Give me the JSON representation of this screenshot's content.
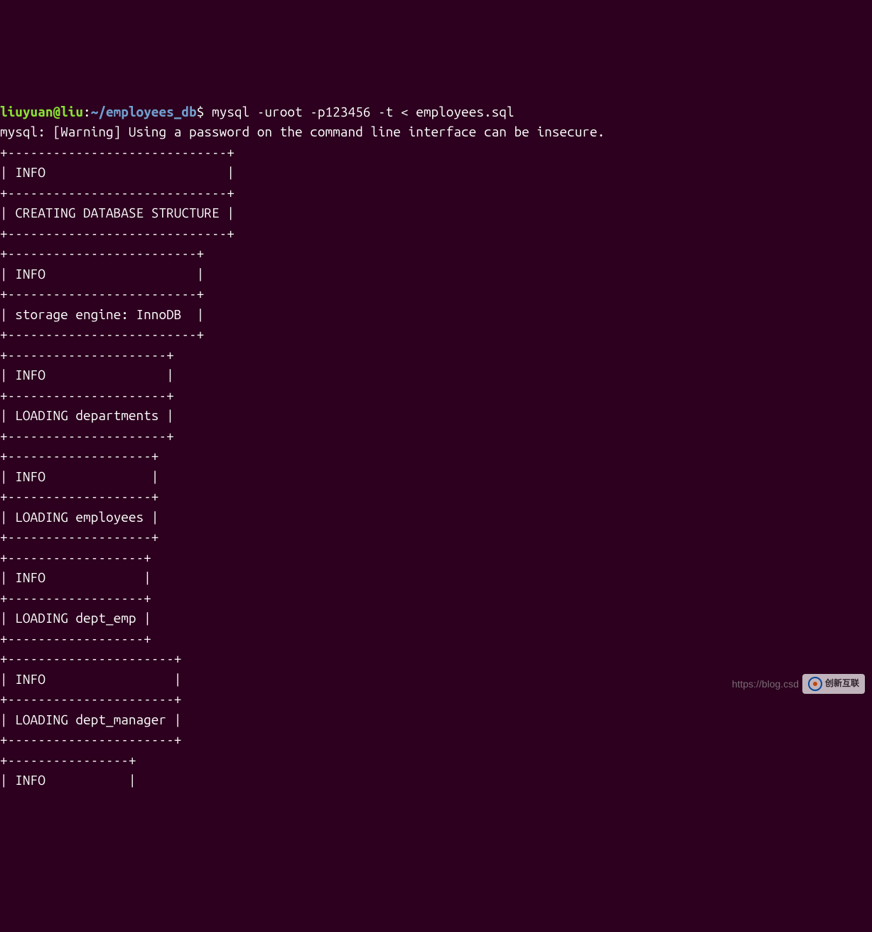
{
  "prompt": {
    "user": "liuyuan@liu",
    "colon": ":",
    "path": "~/employees_db",
    "dollar": "$ ",
    "command": "mysql -uroot -p123456 -t < employees.sql"
  },
  "warning": "mysql: [Warning] Using a password on the command line interface can be insecure.",
  "tables": [
    {
      "border": "+-----------------------------+",
      "header": "| INFO                        |",
      "row": "| CREATING DATABASE STRUCTURE |"
    },
    {
      "border": "+-------------------------+",
      "header": "| INFO                    |",
      "row": "| storage engine: InnoDB  |"
    },
    {
      "border": "+---------------------+",
      "header": "| INFO                |",
      "row": "| LOADING departments |"
    },
    {
      "border": "+-------------------+",
      "header": "| INFO              |",
      "row": "| LOADING employees |"
    },
    {
      "border": "+------------------+",
      "header": "| INFO             |",
      "row": "| LOADING dept_emp |"
    },
    {
      "border": "+----------------------+",
      "header": "| INFO                 |",
      "row": "| LOADING dept_manager |"
    },
    {
      "border": "+----------------+",
      "header": "| INFO           |"
    }
  ],
  "watermark": {
    "text": "https://blog.csd",
    "logo_text": "创新互联"
  }
}
